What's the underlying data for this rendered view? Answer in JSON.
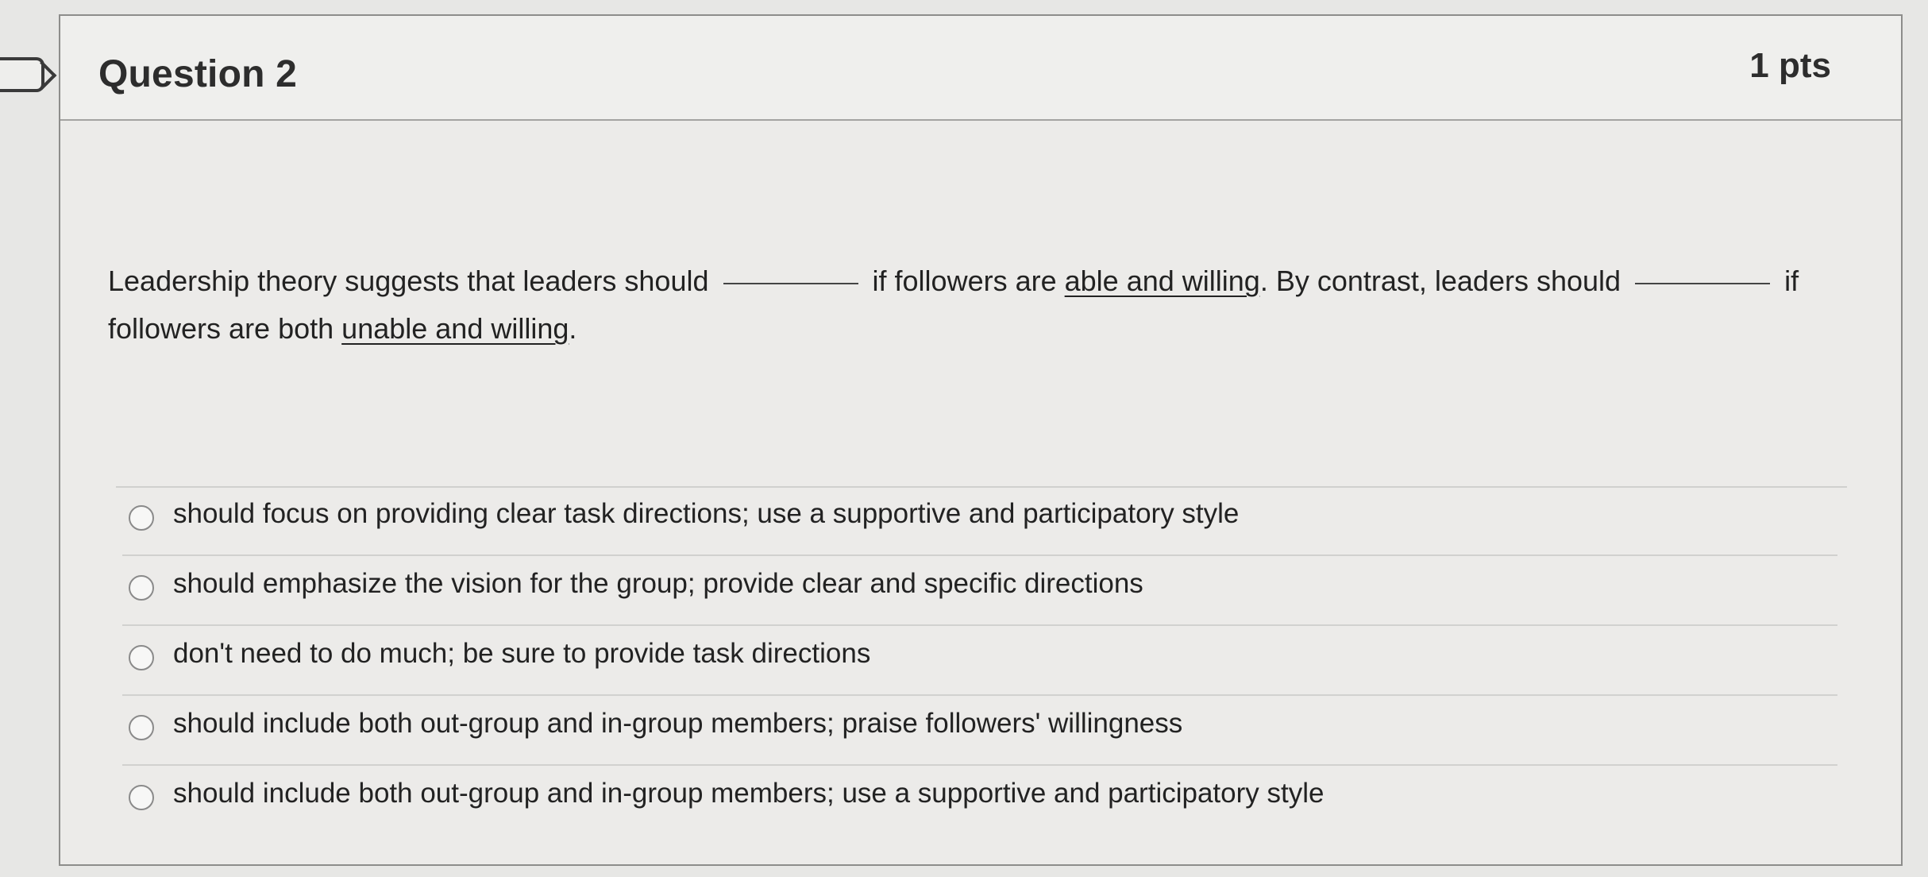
{
  "question": {
    "title": "Question 2",
    "points": "1 pts",
    "text": {
      "part1": "Leadership theory suggests that leaders should",
      "part2": "if followers are",
      "underline1": "able and willing",
      "part3": ". By contrast, leaders should",
      "part4": "if",
      "part5": "followers are both",
      "underline2": "unable and willing",
      "part6": "."
    },
    "answers": [
      "should focus on providing clear task directions; use a supportive and participatory style",
      "should emphasize the vision for the group; provide clear and specific directions",
      "don't need to do much; be sure to provide task directions",
      "should include both out-group and in-group members; praise followers' willingness",
      "should include both out-group and in-group members; use a supportive and participatory style"
    ]
  }
}
